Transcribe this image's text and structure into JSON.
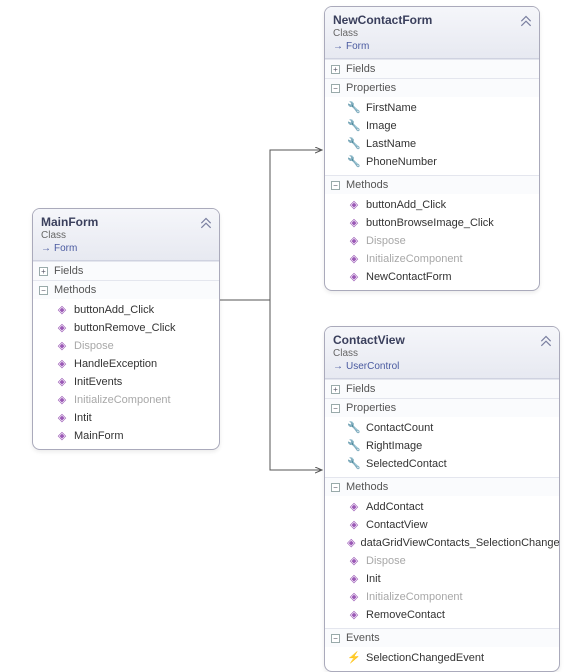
{
  "boxes": {
    "mainform": {
      "title": "MainForm",
      "stereotype": "Class",
      "inherits": "Form",
      "sections": {
        "fields": {
          "label": "Fields",
          "expanded": false
        },
        "methods": {
          "label": "Methods",
          "expanded": true
        }
      },
      "methods": [
        {
          "name": "buttonAdd_Click",
          "grey": false
        },
        {
          "name": "buttonRemove_Click",
          "grey": false
        },
        {
          "name": "Dispose",
          "grey": true
        },
        {
          "name": "HandleException",
          "grey": false
        },
        {
          "name": "InitEvents",
          "grey": false
        },
        {
          "name": "InitializeComponent",
          "grey": true
        },
        {
          "name": "Intit",
          "grey": false
        },
        {
          "name": "MainForm",
          "grey": false
        }
      ]
    },
    "newcontact": {
      "title": "NewContactForm",
      "stereotype": "Class",
      "inherits": "Form",
      "sections": {
        "fields": {
          "label": "Fields",
          "expanded": false
        },
        "properties": {
          "label": "Properties",
          "expanded": true
        },
        "methods": {
          "label": "Methods",
          "expanded": true
        }
      },
      "properties": [
        {
          "name": "FirstName"
        },
        {
          "name": "Image"
        },
        {
          "name": "LastName"
        },
        {
          "name": "PhoneNumber"
        }
      ],
      "methods": [
        {
          "name": "buttonAdd_Click",
          "grey": false
        },
        {
          "name": "buttonBrowseImage_Click",
          "grey": false
        },
        {
          "name": "Dispose",
          "grey": true
        },
        {
          "name": "InitializeComponent",
          "grey": true
        },
        {
          "name": "NewContactForm",
          "grey": false
        }
      ]
    },
    "contactview": {
      "title": "ContactView",
      "stereotype": "Class",
      "inherits": "UserControl",
      "sections": {
        "fields": {
          "label": "Fields",
          "expanded": false
        },
        "properties": {
          "label": "Properties",
          "expanded": true
        },
        "methods": {
          "label": "Methods",
          "expanded": true
        },
        "events": {
          "label": "Events",
          "expanded": true
        }
      },
      "properties": [
        {
          "name": "ContactCount"
        },
        {
          "name": "RightImage"
        },
        {
          "name": "SelectedContact"
        }
      ],
      "methods": [
        {
          "name": "AddContact",
          "grey": false
        },
        {
          "name": "ContactView",
          "grey": false
        },
        {
          "name": "dataGridViewContacts_SelectionChanged",
          "grey": false
        },
        {
          "name": "Dispose",
          "grey": true
        },
        {
          "name": "Init",
          "grey": false
        },
        {
          "name": "InitializeComponent",
          "grey": true
        },
        {
          "name": "RemoveContact",
          "grey": false
        }
      ],
      "events": [
        {
          "name": "SelectionChangedEvent"
        }
      ]
    }
  },
  "ui": {
    "plus": "+",
    "minus": "−",
    "inherit_arrow": "→"
  }
}
